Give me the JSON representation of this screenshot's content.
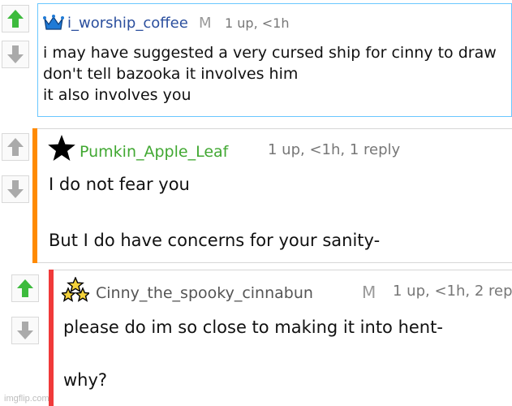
{
  "colors": {
    "upvote": "#3dbb3d",
    "downvote": "#aaaaaa",
    "highlight_border": "#6ac7ff",
    "thread_bar_orange": "#ff8a00",
    "thread_bar_red": "#f03a3a",
    "username_blue": "#2b4f9e",
    "username_green": "#41a832"
  },
  "comments": [
    {
      "username": "i_worship_coffee",
      "mod_badge": "M",
      "meta": "1 up, <1h",
      "user_icon": "crown-icon",
      "lines": [
        "i may have suggested a very cursed ship for cinny to draw",
        "don't tell bazooka it involves him",
        "it also involves you"
      ]
    },
    {
      "username": "Pumkin_Apple_Leaf",
      "meta": "1 up, <1h, 1 reply",
      "user_icon": "black-star-icon",
      "lines": [
        "I do not fear you",
        "",
        "But I do have concerns for your sanity-"
      ]
    },
    {
      "username": "Cinny_the_spooky_cinnabun",
      "mod_badge": "M",
      "meta": "1 up, <1h, 2 rep",
      "user_icon": "three-stars-icon",
      "lines": [
        "please do im so close to making it into hent-",
        "",
        "why?"
      ]
    }
  ],
  "watermark": "imgflip.com"
}
